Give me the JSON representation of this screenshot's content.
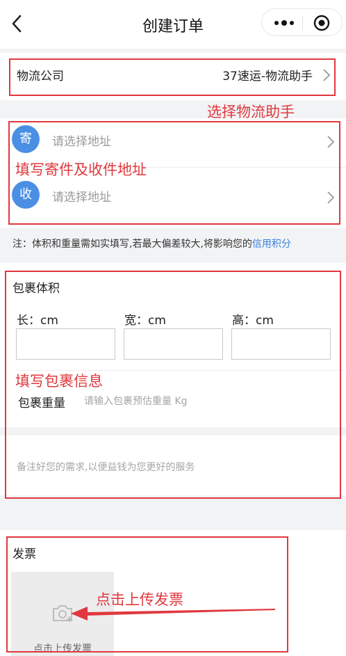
{
  "nav": {
    "title": "创建订单",
    "back_icon": "chevron-left-icon",
    "more_icon": "more-dots-icon",
    "close_icon": "target-circle-icon"
  },
  "logistics": {
    "label": "物流公司",
    "value": "37速运-物流助手"
  },
  "address": {
    "sender_icon": "寄",
    "sender_placeholder": "请选择地址",
    "receiver_icon": "收",
    "receiver_placeholder": "请选择地址"
  },
  "note": {
    "text": "注：体积和重量需如实填写,若最大偏差较大,将影响您的",
    "link": "信用积分"
  },
  "package": {
    "title": "包裹体积",
    "length_label": "长：cm",
    "width_label": "宽：cm",
    "height_label": "高：cm",
    "weight_label": "包裹重量",
    "weight_placeholder": "请输入包裹预估重量 Kg",
    "remark_placeholder": "备注好您的需求,以便益钱为您更好的服务"
  },
  "invoice": {
    "title": "发票",
    "upload_label": "点击上传发票",
    "upload_icon": "camera-plus-icon"
  },
  "annotations": {
    "logistics": "选择物流助手",
    "address": "填写寄件及收件地址",
    "package": "填写包裹信息",
    "invoice": "点击上传发票"
  },
  "colors": {
    "annotation_red": "#e0383e",
    "accent_blue": "#4a8fe3",
    "link_blue": "#3a7fdc"
  }
}
